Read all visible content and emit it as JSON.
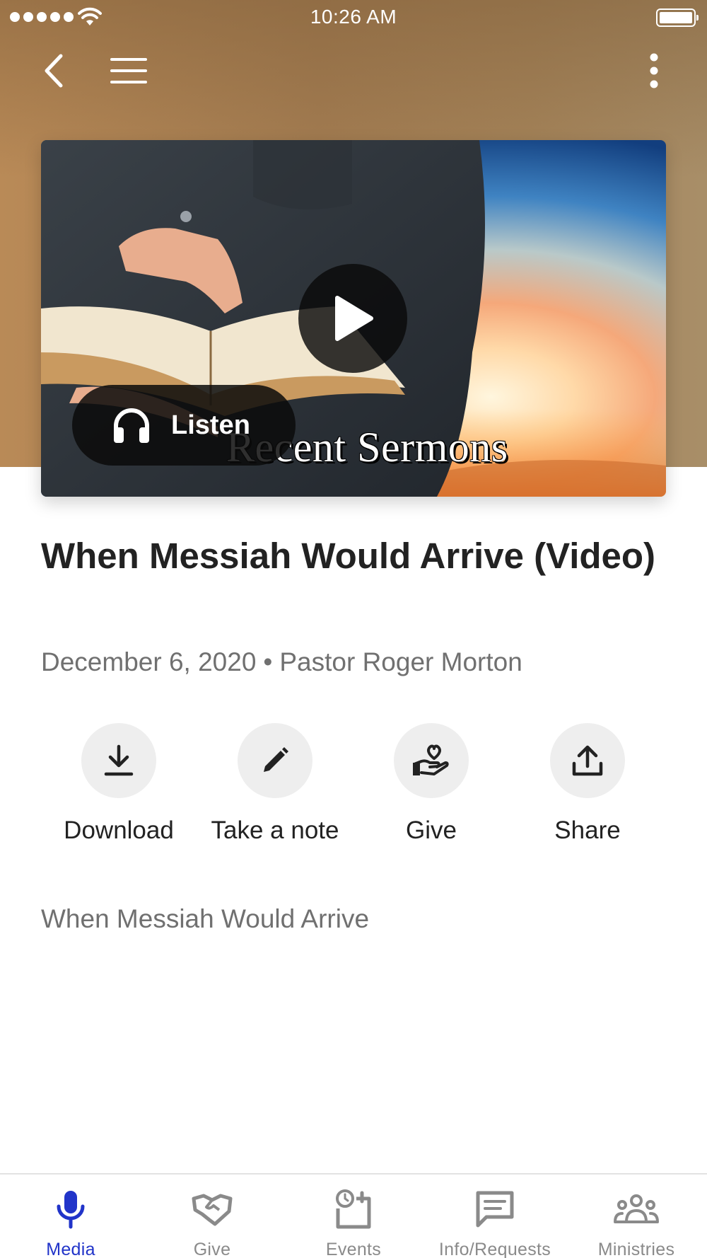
{
  "status_bar": {
    "time": "10:26 AM",
    "signal_icon": "signal-dots-icon",
    "wifi_icon": "wifi-icon",
    "battery_icon": "battery-full-icon"
  },
  "nav": {
    "back_icon": "chevron-left-icon",
    "menu_icon": "hamburger-menu-icon",
    "more_icon": "more-vertical-icon"
  },
  "video": {
    "overlay_title": "Recent Sermons",
    "play_icon": "play-icon",
    "listen_label": "Listen",
    "listen_icon": "headphones-icon"
  },
  "sermon": {
    "title": "When Messiah Would Arrive (Video)",
    "date": "December 6, 2020",
    "separator": "•",
    "speaker": "Pastor Roger Morton",
    "description": "When Messiah Would Arrive"
  },
  "actions": [
    {
      "label": "Download",
      "icon": "download-icon"
    },
    {
      "label": "Take a note",
      "icon": "pencil-icon"
    },
    {
      "label": "Give",
      "icon": "hand-heart-icon"
    },
    {
      "label": "Share",
      "icon": "share-icon"
    }
  ],
  "tabs": [
    {
      "label": "Media",
      "icon": "microphone-icon",
      "active": true
    },
    {
      "label": "Give",
      "icon": "handshake-icon",
      "active": false
    },
    {
      "label": "Events",
      "icon": "calendar-clock-icon",
      "active": false
    },
    {
      "label": "Info/Requests",
      "icon": "message-icon",
      "active": false
    },
    {
      "label": "Ministries",
      "icon": "people-group-icon",
      "active": false
    }
  ],
  "colors": {
    "accent": "#2134c9",
    "hero_bg": "#a47d52",
    "muted_text": "#707070"
  }
}
